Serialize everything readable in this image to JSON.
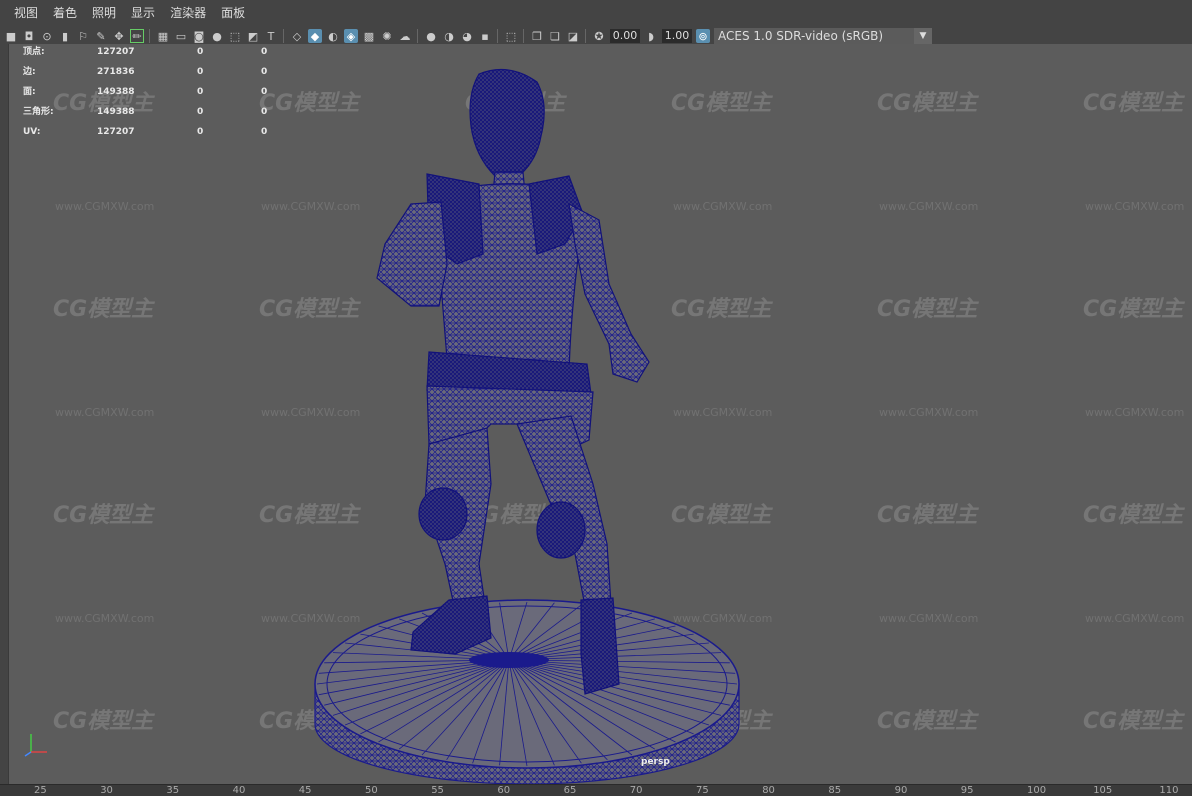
{
  "menu": [
    "视图",
    "着色",
    "照明",
    "显示",
    "渲染器",
    "面板"
  ],
  "toolbar": {
    "exposure_value": "0.00",
    "gamma_value": "1.00",
    "color_space": "ACES 1.0 SDR-video (sRGB)"
  },
  "hud": {
    "rows": [
      {
        "label": "顶点:",
        "v1": "127207",
        "v2": "0",
        "v3": "0"
      },
      {
        "label": "边:",
        "v1": "271836",
        "v2": "0",
        "v3": "0"
      },
      {
        "label": "面:",
        "v1": "149388",
        "v2": "0",
        "v3": "0"
      },
      {
        "label": "三角形:",
        "v1": "149388",
        "v2": "0",
        "v3": "0"
      },
      {
        "label": "UV:",
        "v1": "127207",
        "v2": "0",
        "v3": "0"
      }
    ]
  },
  "camera_label": "persp",
  "watermark": {
    "logo": "CG模型主",
    "url": "www.CGMXW.com"
  },
  "ruler_ticks": [
    "25",
    "30",
    "35",
    "40",
    "45",
    "50",
    "55",
    "60",
    "65",
    "70",
    "75",
    "80",
    "85",
    "90",
    "95",
    "100",
    "105",
    "110"
  ],
  "colors": {
    "wireframe": "#1a1a8c",
    "viewport_bg": "#5c5c5c"
  }
}
